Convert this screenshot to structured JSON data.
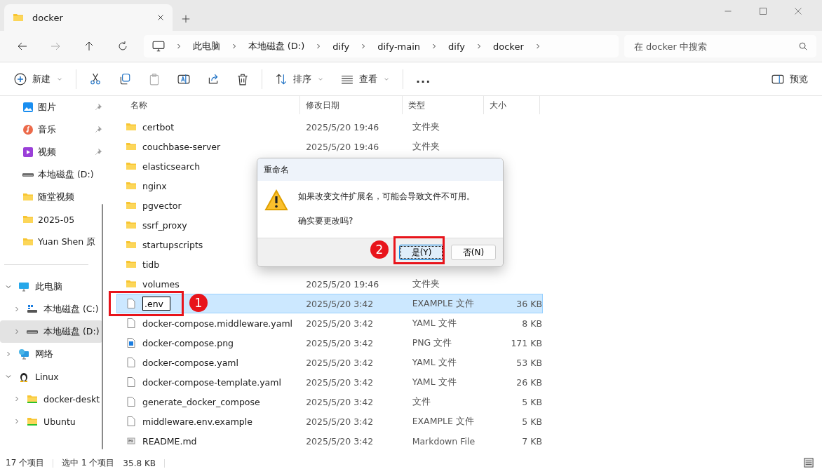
{
  "tab": {
    "title": "docker"
  },
  "address": {
    "crumbs": [
      "此电脑",
      "本地磁盘 (D:)",
      "dify",
      "dify-main",
      "dify",
      "docker"
    ]
  },
  "search": {
    "placeholder": "在 docker 中搜索"
  },
  "toolbar": [
    {
      "kind": "new",
      "label": "新建",
      "disabled": false
    },
    {
      "kind": "cut",
      "disabled": false
    },
    {
      "kind": "copy",
      "disabled": false
    },
    {
      "kind": "paste",
      "disabled": true
    },
    {
      "kind": "rename",
      "disabled": false
    },
    {
      "kind": "share",
      "disabled": false
    },
    {
      "kind": "delete",
      "disabled": false
    },
    {
      "kind": "sort",
      "label": "排序",
      "disabled": false
    },
    {
      "kind": "view",
      "label": "查看",
      "disabled": false
    },
    {
      "kind": "more",
      "label": "...",
      "disabled": false
    }
  ],
  "preview": {
    "label": "预览"
  },
  "quick_access": [
    {
      "kind": "pictures",
      "label": "图片",
      "pinned": true
    },
    {
      "kind": "music",
      "label": "音乐",
      "pinned": true
    },
    {
      "kind": "videos",
      "label": "视频",
      "pinned": true
    },
    {
      "kind": "drive",
      "label": "本地磁盘 (D:)",
      "pinned": false
    },
    {
      "kind": "folder",
      "label": "随堂视频",
      "pinned": false
    },
    {
      "kind": "folder",
      "label": "2025-05",
      "pinned": false
    },
    {
      "kind": "folder",
      "label": "Yuan Shen 原",
      "pinned": false
    }
  ],
  "tree": [
    {
      "kind": "pc",
      "label": "此电脑",
      "expanded": true,
      "selected": false,
      "children": [
        {
          "kind": "windrive",
          "label": "本地磁盘 (C:)",
          "expanded": false,
          "selected": false
        },
        {
          "kind": "drive",
          "label": "本地磁盘 (D:)",
          "expanded": false,
          "selected": true
        }
      ]
    },
    {
      "kind": "network",
      "label": "网络",
      "expanded": false,
      "selected": false
    },
    {
      "kind": "linux",
      "label": "Linux",
      "expanded": true,
      "selected": false,
      "children": [
        {
          "kind": "distro",
          "label": "docker-deskt",
          "expanded": false,
          "selected": false
        },
        {
          "kind": "distro",
          "label": "Ubuntu",
          "expanded": false,
          "selected": false
        }
      ]
    }
  ],
  "columns": [
    "名称",
    "修改日期",
    "类型",
    "大小"
  ],
  "files": [
    {
      "kind": "folder",
      "name": "certbot",
      "date": "2025/5/20 19:46",
      "type": "文件夹",
      "selected": false
    },
    {
      "kind": "folder",
      "name": "couchbase-server",
      "date": "2025/5/20 19:46",
      "type": "文件夹",
      "selected": false
    },
    {
      "kind": "folder",
      "name": "elasticsearch",
      "selected": false
    },
    {
      "kind": "folder",
      "name": "nginx",
      "selected": false
    },
    {
      "kind": "folder",
      "name": "pgvector",
      "selected": false
    },
    {
      "kind": "folder",
      "name": "ssrf_proxy",
      "selected": false
    },
    {
      "kind": "folder",
      "name": "startupscripts",
      "selected": false
    },
    {
      "kind": "folder",
      "name": "tidb",
      "selected": false
    },
    {
      "kind": "folder",
      "name": "volumes",
      "date": "2025/5/20 19:46",
      "type": "文件夹",
      "selected": false
    },
    {
      "kind": "file",
      "name": ".env",
      "date": "2025/5/20 3:42",
      "type": "EXAMPLE 文件",
      "size": "36 KB",
      "selected": true,
      "renaming": true
    },
    {
      "kind": "file",
      "name": "docker-compose.middleware.yaml",
      "date": "2025/5/20 3:42",
      "type": "YAML 文件",
      "size": "8 KB",
      "selected": false
    },
    {
      "kind": "image",
      "name": "docker-compose.png",
      "date": "2025/5/20 3:42",
      "type": "PNG 文件",
      "size": "171 KB",
      "selected": false
    },
    {
      "kind": "file",
      "name": "docker-compose.yaml",
      "date": "2025/5/20 3:42",
      "type": "YAML 文件",
      "size": "53 KB",
      "selected": false
    },
    {
      "kind": "file",
      "name": "docker-compose-template.yaml",
      "date": "2025/5/20 3:42",
      "type": "YAML 文件",
      "size": "26 KB",
      "selected": false
    },
    {
      "kind": "file",
      "name": "generate_docker_compose",
      "date": "2025/5/20 3:42",
      "type": "文件",
      "size": "5 KB",
      "selected": false
    },
    {
      "kind": "file",
      "name": "middleware.env.example",
      "date": "2025/5/20 3:42",
      "type": "EXAMPLE 文件",
      "size": "5 KB",
      "selected": false
    },
    {
      "kind": "markdown",
      "name": "README.md",
      "date": "2025/5/20 3:42",
      "type": "Markdown File",
      "size": "7 KB",
      "selected": false
    }
  ],
  "status_bar": {
    "count": "17 个项目",
    "selection": "选中 1 个项目",
    "size": "35.8 KB"
  },
  "dialog": {
    "title": "重命名",
    "message": "如果改变文件扩展名，可能会导致文件不可用。",
    "question": "确实要更改吗?",
    "buttons": [
      {
        "label": "是(Y)",
        "default": true
      },
      {
        "label": "否(N)",
        "default": false
      }
    ]
  },
  "annotations": [
    {
      "number": "1"
    },
    {
      "number": "2"
    }
  ]
}
